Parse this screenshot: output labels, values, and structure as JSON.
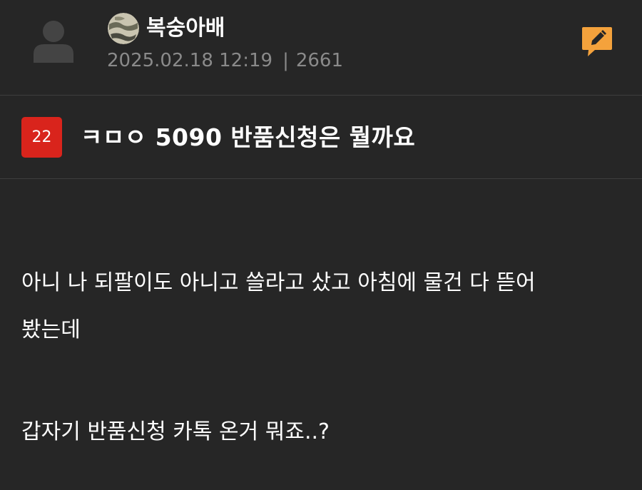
{
  "post": {
    "author": "복숭아배",
    "date": "2025.02.18 12:19",
    "separator": "|",
    "views": "2661",
    "comment_count": "22",
    "title": "ㅋㅁㅇ 5090 반품신청은 뭘까요",
    "body_lines": [
      "아니 나 되팔이도 아니고 쓸라고 샀고 아침에 물건 다 뜯어",
      "봤는데",
      "갑자기 반품신청 카톡 온거 뭐죠..?"
    ]
  },
  "icons": {
    "avatar": "user-silhouette-icon",
    "author_badge": "camouflage-badge-icon",
    "edit": "pencil-speech-bubble-icon"
  },
  "colors": {
    "background": "#262626",
    "accent_orange": "#f4a23c",
    "badge_red": "#d9241c",
    "meta_gray": "#8a8a8a"
  }
}
